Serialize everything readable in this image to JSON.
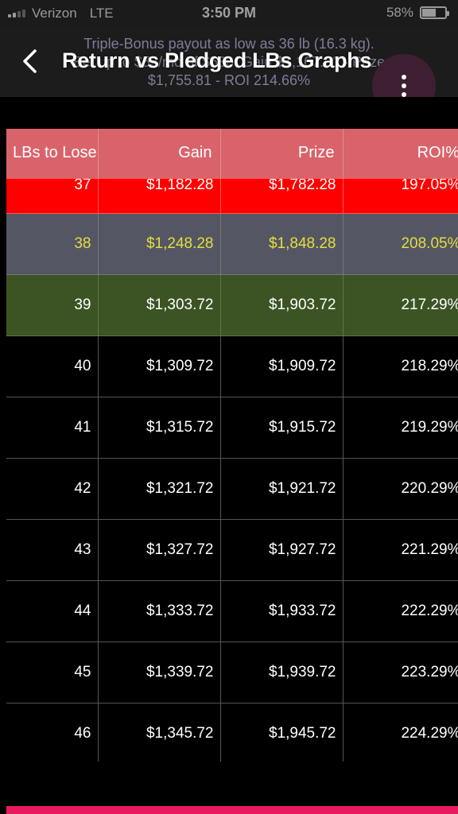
{
  "status_bar": {
    "carrier": "Verizon",
    "network": "LTE",
    "time": "3:50 PM",
    "battery": "58%",
    "battery_level": 0.58
  },
  "header": {
    "subtitle_line1": "Triple-Bonus payout as low as 36 lb (16.3 kg).",
    "subtitle_line2": "Bet up to $53/mo of $630. Gain $1,167.81 - Prize",
    "subtitle_line3": "$1,755.81 - ROI 214.66%",
    "title": "Return vs Pledged LBs Graphs",
    "back_icon": "chevron-left-icon",
    "menu_icon": "more-vertical-icon"
  },
  "table": {
    "columns": [
      "LBs to Lose",
      "Gain",
      "Prize",
      "ROI%"
    ],
    "rows": [
      {
        "lbs": "37",
        "gain": "$1,182.28",
        "prize": "$1,782.28",
        "roi": "197.05%",
        "style": "red"
      },
      {
        "lbs": "38",
        "gain": "$1,248.28",
        "prize": "$1,848.28",
        "roi": "208.05%",
        "style": "gray"
      },
      {
        "lbs": "39",
        "gain": "$1,303.72",
        "prize": "$1,903.72",
        "roi": "217.29%",
        "style": "green"
      },
      {
        "lbs": "40",
        "gain": "$1,309.72",
        "prize": "$1,909.72",
        "roi": "218.29%",
        "style": "plain"
      },
      {
        "lbs": "41",
        "gain": "$1,315.72",
        "prize": "$1,915.72",
        "roi": "219.29%",
        "style": "plain"
      },
      {
        "lbs": "42",
        "gain": "$1,321.72",
        "prize": "$1,921.72",
        "roi": "220.29%",
        "style": "plain"
      },
      {
        "lbs": "43",
        "gain": "$1,327.72",
        "prize": "$1,927.72",
        "roi": "221.29%",
        "style": "plain"
      },
      {
        "lbs": "44",
        "gain": "$1,333.72",
        "prize": "$1,933.72",
        "roi": "222.29%",
        "style": "plain"
      },
      {
        "lbs": "45",
        "gain": "$1,339.72",
        "prize": "$1,939.72",
        "roi": "223.29%",
        "style": "plain"
      },
      {
        "lbs": "46",
        "gain": "$1,345.72",
        "prize": "$1,945.72",
        "roi": "224.29%",
        "style": "plain"
      }
    ]
  },
  "colors": {
    "header_row": "#d9636b",
    "row_red": "#ff0000",
    "row_gray": "#545763",
    "row_gray_text": "#e4de3c",
    "row_green": "#3c5424",
    "bottom_bar": "#e8195f"
  }
}
